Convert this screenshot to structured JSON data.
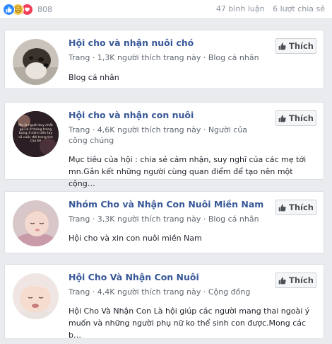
{
  "post_stats": {
    "reaction_count": "808",
    "comments": "47 bình luận",
    "shares": "6 lượt chia sẻ"
  },
  "results": [
    {
      "name": "Hội cho và nhận nuôi chó",
      "meta": "Trang · 1,3K người thích trang này · Blog cá nhân",
      "description": "Blog cá nhân",
      "like_label": "Thích",
      "avatar_icon": "dog-photo"
    },
    {
      "name": "Hội cho và nhận con nuôi",
      "meta": "Trang · 4,6K người thích trang này · Người của công chúng",
      "description": "Mục tiêu của hội : chia sẻ cảm nhận, suy nghĩ của các mẹ tới mn.Gắn kết những người cùng quan điểm để tạo nên một cộng…",
      "like_label": "Thích",
      "avatar_icon": "quote-poster",
      "avatar_text": "Mẹ là người duy nhất gọi là 9 tháng trong bụng 3 năm trên tay cả cuộc đời trong tim của bé"
    },
    {
      "name": "Nhóm Cho và Nhận Con Nuôi Miền Nam",
      "meta": "Trang · 3,3K người thích trang này · Blog cá nhân",
      "description": "Hội cho và xin con nuôi miền Nam",
      "like_label": "Thích",
      "avatar_icon": "baby-photo"
    },
    {
      "name": "Hội Cho Và Nhận Con Nuôi",
      "meta": "Trang · 4,4K người thích trang này · Cộng đồng",
      "description": "Hội Cho Và Nhận Con Là hội giúp các người mang thai ngoài ý muốn và những người phụ nữ ko thể sinh con được.Mong các b…",
      "like_label": "Thích",
      "avatar_icon": "baby-photo"
    }
  ]
}
